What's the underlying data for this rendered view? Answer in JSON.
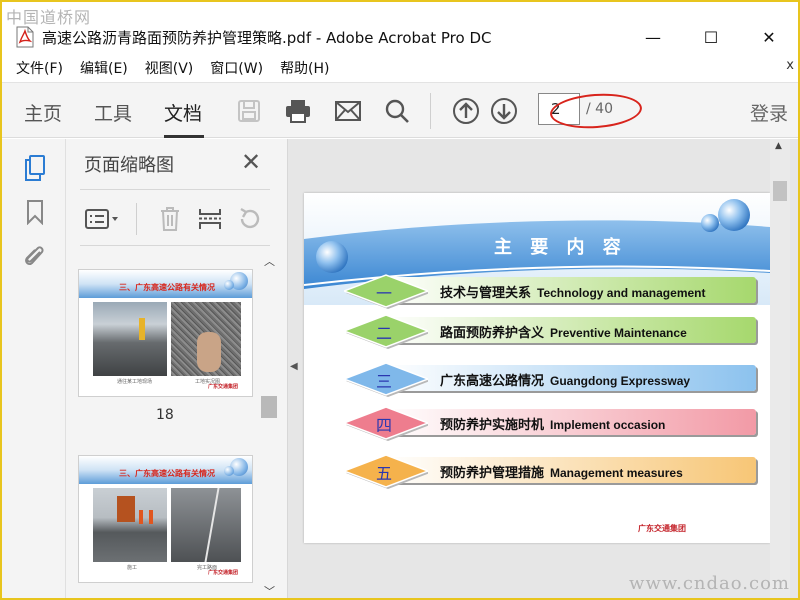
{
  "watermark": {
    "top": "中国道桥网",
    "bottom": "www.cndao.com"
  },
  "window": {
    "title": "高速公路沥青路面预防养护管理策略.pdf - Adobe Acrobat Pro DC",
    "buttons": {
      "minimize": "—",
      "maximize": "☐",
      "close": "✕"
    }
  },
  "menu": {
    "items": [
      "文件(F)",
      "编辑(E)",
      "视图(V)",
      "窗口(W)",
      "帮助(H)"
    ],
    "close": "x"
  },
  "toolbar": {
    "tabs": [
      "主页",
      "工具",
      "文档"
    ],
    "active_tab": "文档",
    "icons": [
      "save-icon",
      "print-icon",
      "email-icon",
      "search-icon",
      "arrow-up-icon",
      "arrow-down-icon"
    ],
    "page_current": "2",
    "page_total": "/ 40",
    "login": "登录"
  },
  "rail": {
    "icons": [
      "page-thumbnails-icon",
      "bookmark-icon",
      "attachment-icon"
    ]
  },
  "thumbnails_panel": {
    "title": "页面缩略图",
    "close": "✕",
    "thumbs": [
      {
        "title": "三、广东高速公路有关情况",
        "caption_left": "通往某工地现场",
        "caption_right": "工地实况图",
        "logo": "广东交通集团",
        "label": "18"
      },
      {
        "title": "三、广东高速公路有关情况",
        "caption_left": "施工",
        "caption_right": "完工路面",
        "logo": "广东交通集团",
        "label": ""
      }
    ]
  },
  "document": {
    "slide_title": "主 要 内 容",
    "rows": [
      {
        "num": "一",
        "zh": "技术与管理关系",
        "en": "Technology and management",
        "color": "#a6d86d",
        "diamond": "#9ad26a"
      },
      {
        "num": "二",
        "zh": "路面预防养护含义",
        "en": "Preventive Maintenance",
        "color": "#a6d86d",
        "diamond": "#9ad26a"
      },
      {
        "num": "三",
        "zh": "广东高速公路情况",
        "en": "Guangdong Expressway",
        "color": "#8cc2ee",
        "diamond": "#7fb8ea"
      },
      {
        "num": "四",
        "zh": "预防养护实施时机",
        "en": "Implement occasion",
        "color": "#f29aa6",
        "diamond": "#ee7d8e"
      },
      {
        "num": "五",
        "zh": "预防养护管理措施",
        "en": "Management measures",
        "color": "#f7c676",
        "diamond": "#f5b24c"
      }
    ],
    "logo": "广东交通集团"
  }
}
